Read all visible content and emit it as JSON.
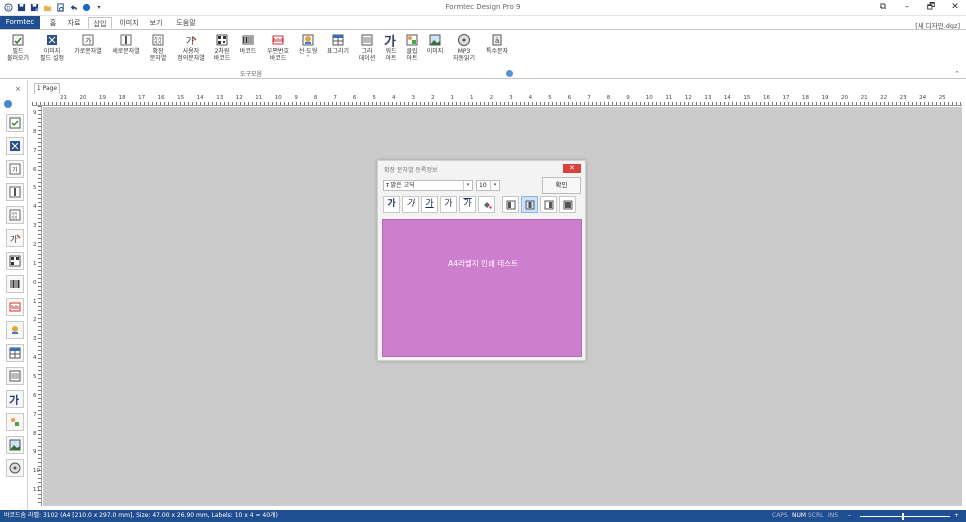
{
  "window": {
    "title": "Formtec Design Pro 9",
    "document_name": "[새 디자인.dgz]",
    "controls": [
      "⧉",
      "–",
      "🗗",
      "✕"
    ]
  },
  "tabs": [
    {
      "label": "Formtec",
      "key": "file"
    },
    {
      "label": "홈",
      "key": "home"
    },
    {
      "label": "자료",
      "key": "data"
    },
    {
      "label": "삽입",
      "key": "insert",
      "active": true
    },
    {
      "label": "이미지",
      "key": "image"
    },
    {
      "label": "보기",
      "key": "view"
    },
    {
      "label": "도움말",
      "key": "help"
    }
  ],
  "ribbon": {
    "items": [
      {
        "line1": "필드",
        "line2": "불러오기",
        "icon": "field-load-icon"
      },
      {
        "line1": "이미지",
        "line2": "필드 설정",
        "icon": "image-field-icon"
      },
      {
        "line1": "가로문자열",
        "line2": "",
        "icon": "horizontal-text-icon"
      },
      {
        "line1": "세로문자열",
        "line2": "",
        "icon": "vertical-text-icon"
      },
      {
        "line1": "확장",
        "line2": "문자열",
        "icon": "extended-text-icon"
      },
      {
        "line1": "사용자",
        "line2": "정의문자열",
        "icon": "custom-text-icon"
      },
      {
        "line1": "2차원",
        "line2": "바코드",
        "icon": "2d-barcode-icon"
      },
      {
        "line1": "바코드",
        "line2": "",
        "icon": "barcode-icon"
      },
      {
        "line1": "우편번호",
        "line2": "바코드",
        "icon": "postal-barcode-icon"
      },
      {
        "line1": "선·도형",
        "line2": "˅",
        "icon": "shape-icon"
      },
      {
        "line1": "표그리기",
        "line2": "",
        "icon": "table-icon"
      },
      {
        "line1": "그라",
        "line2": "데이션",
        "icon": "gradient-icon"
      },
      {
        "line1": "워드",
        "line2": "아트",
        "icon": "wordart-icon"
      },
      {
        "line1": "클립",
        "line2": "아트",
        "icon": "clipart-icon"
      },
      {
        "line1": "이미지",
        "line2": "",
        "icon": "picture-icon"
      },
      {
        "line1": "MP3",
        "line2": "자동읽기",
        "icon": "mp3-icon"
      },
      {
        "line1": "특수문자",
        "line2": "",
        "icon": "special-char-icon"
      }
    ],
    "group_label": "도구모음"
  },
  "toolbox": {
    "close": "×",
    "icons": [
      "field-load-icon",
      "image-field-icon",
      "horizontal-text-icon",
      "vertical-text-icon",
      "extended-text-icon",
      "custom-text-icon",
      "2d-barcode-icon",
      "barcode-icon",
      "postal-barcode-icon",
      "shape-icon",
      "table-icon",
      "gradient-icon",
      "wordart-icon",
      "clipart-icon",
      "picture-icon",
      "mp3-icon"
    ]
  },
  "document_tab": "1 Page",
  "ruler": {
    "h_labels": [
      "21",
      "20",
      "19",
      "18",
      "17",
      "16",
      "15",
      "14",
      "13",
      "12",
      "11",
      "10",
      "9",
      "8",
      "7",
      "6",
      "5",
      "4",
      "3",
      "2",
      "1",
      "1",
      "2",
      "3",
      "4",
      "5",
      "6",
      "7",
      "8",
      "9",
      "10",
      "11",
      "12",
      "13",
      "14",
      "15",
      "16",
      "17",
      "18",
      "19",
      "20",
      "21",
      "22",
      "23",
      "24",
      "25"
    ],
    "v_labels": [
      "9",
      "8",
      "7",
      "6",
      "5",
      "4",
      "3",
      "2",
      "1",
      "0",
      "1",
      "2",
      "3",
      "4",
      "5",
      "6",
      "7",
      "8",
      "9",
      "10",
      "11"
    ]
  },
  "dialog": {
    "title": "확장 문자열 등록정보",
    "close": "✕",
    "font_name": "맑은 고딕",
    "font_size": "10",
    "ok_label": "확인",
    "format_buttons": [
      "가",
      "가",
      "가",
      "가",
      "가"
    ],
    "preview_text": "A4라벨지 인쇄 테스트",
    "preview_color": "#cd7ecd"
  },
  "status": {
    "left": "바코드솜 라벨: 3102 (A4 [210.0 x 297.0 mm], Size: 47.00 x 26.90 mm, Labels: 10 x 4 = 40개)",
    "caps": "CAPS",
    "num": "NUM",
    "scrl": "SCRL",
    "ins": "INS",
    "zoom_minus": "–",
    "zoom_plus": "+"
  }
}
